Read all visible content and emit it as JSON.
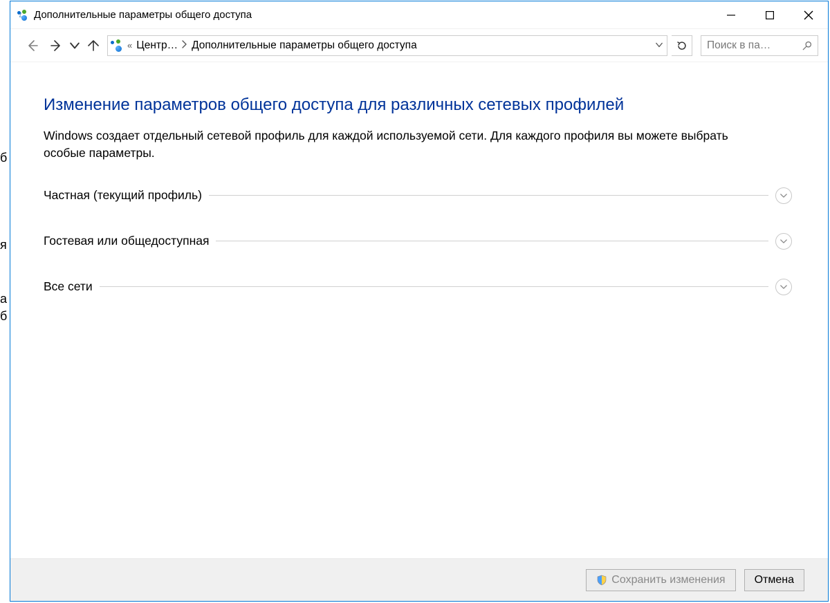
{
  "title": "Дополнительные параметры общего доступа",
  "breadcrumb": {
    "lead": "«",
    "parent": "Центр…",
    "current": "Дополнительные параметры общего доступа"
  },
  "search_placeholder": "Поиск в па…",
  "main": {
    "heading": "Изменение параметров общего доступа для различных сетевых профилей",
    "description": "Windows создает отдельный сетевой профиль для каждой используемой сети. Для каждого профиля вы можете выбрать особые параметры.",
    "sections": [
      "Частная (текущий профиль)",
      "Гостевая или общедоступная",
      "Все сети"
    ]
  },
  "footer": {
    "save": "Сохранить изменения",
    "cancel": "Отмена"
  }
}
